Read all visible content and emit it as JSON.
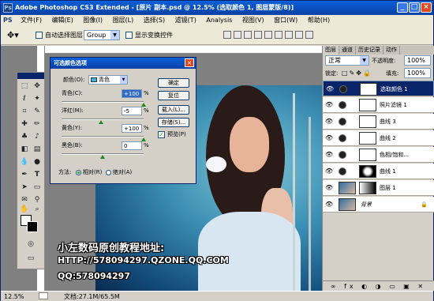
{
  "window": {
    "title": "Adobe Photoshop CS3 Extended - [原片 副本.psd @ 12.5% (选取颜色 1, 图层蒙版/8)]",
    "minimize": "_",
    "maximize": "□",
    "close": "×"
  },
  "menu": [
    "PS",
    "文件(F)",
    "编辑(E)",
    "图像(I)",
    "图层(L)",
    "选择(S)",
    "滤镜(T)",
    "Analysis",
    "视图(V)",
    "窗口(W)",
    "帮助(H)"
  ],
  "options": {
    "auto_select_label": "自动选择图层",
    "group_value": "Group",
    "show_transform_label": "显示变换控件"
  },
  "dialog": {
    "title": "可选颜色选项",
    "colors_label": "颜色(O):",
    "colors_value": "青色",
    "cyan_label": "青色(C):",
    "cyan_value": "+100",
    "magenta_label": "洋红(M):",
    "magenta_value": "-5",
    "yellow_label": "黄色(Y):",
    "yellow_value": "+100",
    "black_label": "黑色(B):",
    "black_value": "0",
    "percent": "%",
    "ok": "确定",
    "reset": "复位",
    "load": "载入(L)...",
    "save": "存储(S)...",
    "preview_label": "预览(P)",
    "method_label": "方法:",
    "relative_label": "相对(R)",
    "absolute_label": "绝对(A)"
  },
  "watermark": {
    "line1": "小左数码原创教程地址:",
    "line2": "HTTP://578094297.QZONE.QQ.COM",
    "line3": "QQ:578094297"
  },
  "status": {
    "zoom": "12.5%",
    "doc": "文档:27.1M/65.5M"
  },
  "layers_panel": {
    "tabs": [
      "图层",
      "通道",
      "历史记录",
      "动作"
    ],
    "blend_mode": "正常",
    "opacity_label": "不透明度:",
    "opacity_value": "100%",
    "lock_label": "锁定:",
    "fill_label": "填充:",
    "fill_value": "100%",
    "layers": [
      {
        "name": "选取颜色 1",
        "selected": true
      },
      {
        "name": "照片滤镜 1",
        "selected": false
      },
      {
        "name": "曲线 3",
        "selected": false
      },
      {
        "name": "曲线 2",
        "selected": false
      },
      {
        "name": "色相/饱和...",
        "selected": false
      },
      {
        "name": "曲线 1",
        "selected": false
      },
      {
        "name": "图层 1",
        "selected": false
      },
      {
        "name": "背景",
        "selected": false
      }
    ],
    "footer_icons": "∞ fx ◐ ◑ ▭ ▣ ✕"
  },
  "colors": {
    "titlebar": "#0a5fd8",
    "selected_layer": "#0a246a"
  }
}
